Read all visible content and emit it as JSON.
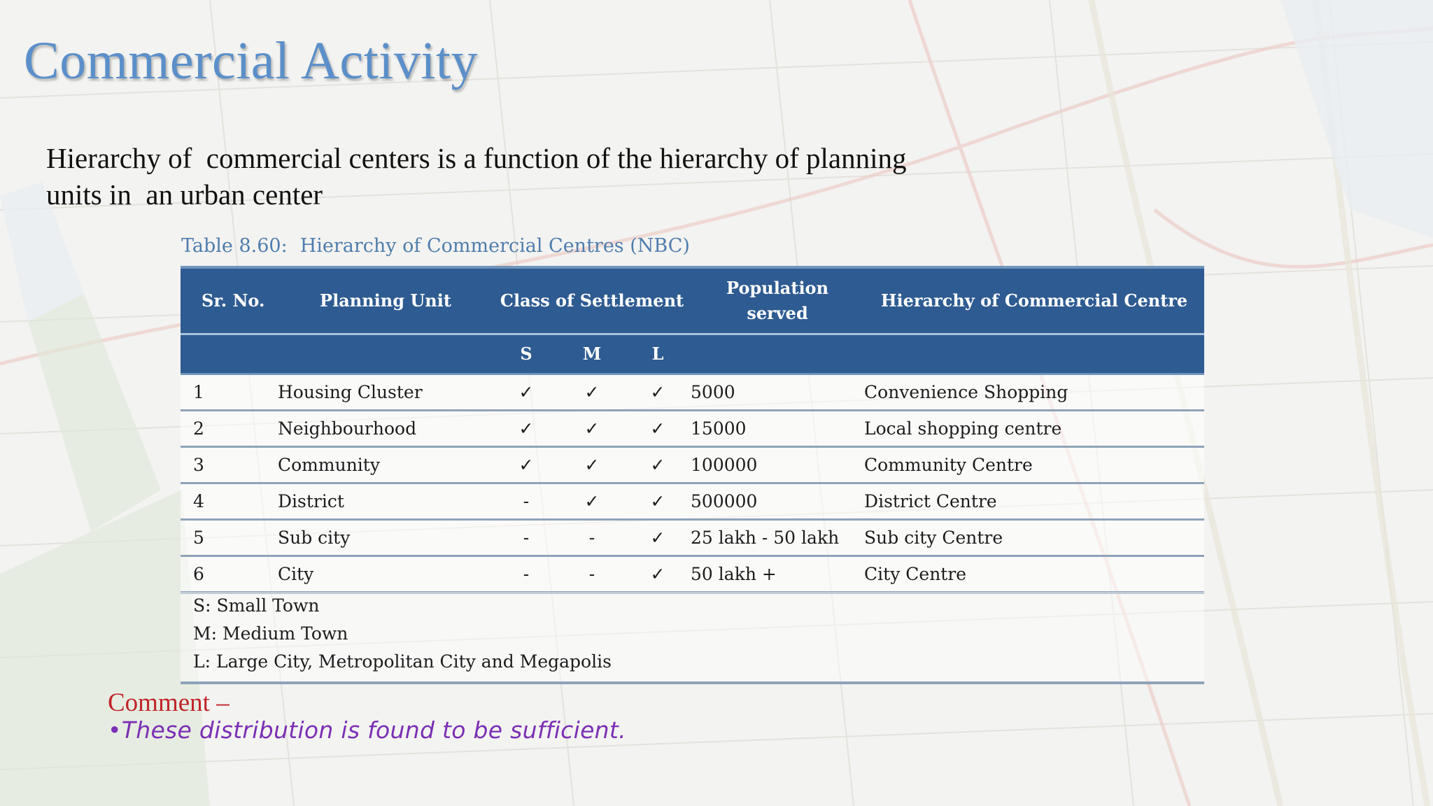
{
  "slide": {
    "title": "Commercial Activity",
    "intro_line1": "Hierarchy of  commercial centers is a function of the hierarchy of planning",
    "intro_line2": "units in  an urban center",
    "caption_number": "Table 8.60:",
    "caption_title": "Hierarchy of Commercial Centres (NBC)"
  },
  "table": {
    "headers": {
      "sr_no": "Sr. No.",
      "planning_unit": "Planning Unit",
      "class_of_settlement": "Class of Settlement",
      "population_served_1": "Population",
      "population_served_2": "served",
      "hierarchy": "Hierarchy of Commercial Centre",
      "s": "S",
      "m": "M",
      "l": "L"
    },
    "rows": [
      {
        "sr": "1",
        "unit": "Housing Cluster",
        "s": "✓",
        "m": "✓",
        "l": "✓",
        "population": "5000",
        "centre": "Convenience Shopping"
      },
      {
        "sr": "2",
        "unit": "Neighbourhood",
        "s": "✓",
        "m": "✓",
        "l": "✓",
        "population": "15000",
        "centre": "Local shopping centre"
      },
      {
        "sr": "3",
        "unit": "Community",
        "s": "✓",
        "m": "✓",
        "l": "✓",
        "population": "100000",
        "centre": "Community Centre"
      },
      {
        "sr": "4",
        "unit": "District",
        "s": "-",
        "m": "✓",
        "l": "✓",
        "population": "500000",
        "centre": "District Centre"
      },
      {
        "sr": "5",
        "unit": "Sub city",
        "s": "-",
        "m": "-",
        "l": "✓",
        "population": "25 lakh - 50 lakh",
        "centre": "Sub city Centre"
      },
      {
        "sr": "6",
        "unit": "City",
        "s": "-",
        "m": "-",
        "l": "✓",
        "population": "50 lakh +",
        "centre": "City Centre"
      }
    ],
    "notes": [
      "S: Small Town",
      "M: Medium Town",
      "L: Large City, Metropolitan City and Megapolis"
    ]
  },
  "comment": {
    "label": "Comment –",
    "text": "•These distribution is found to be sufficient."
  },
  "colors": {
    "title": "#5b8fc9",
    "header_bg": "#2e5b91",
    "caption": "#4f7dad",
    "comment_label": "#c0252a",
    "comment_text": "#7b2fb4"
  }
}
